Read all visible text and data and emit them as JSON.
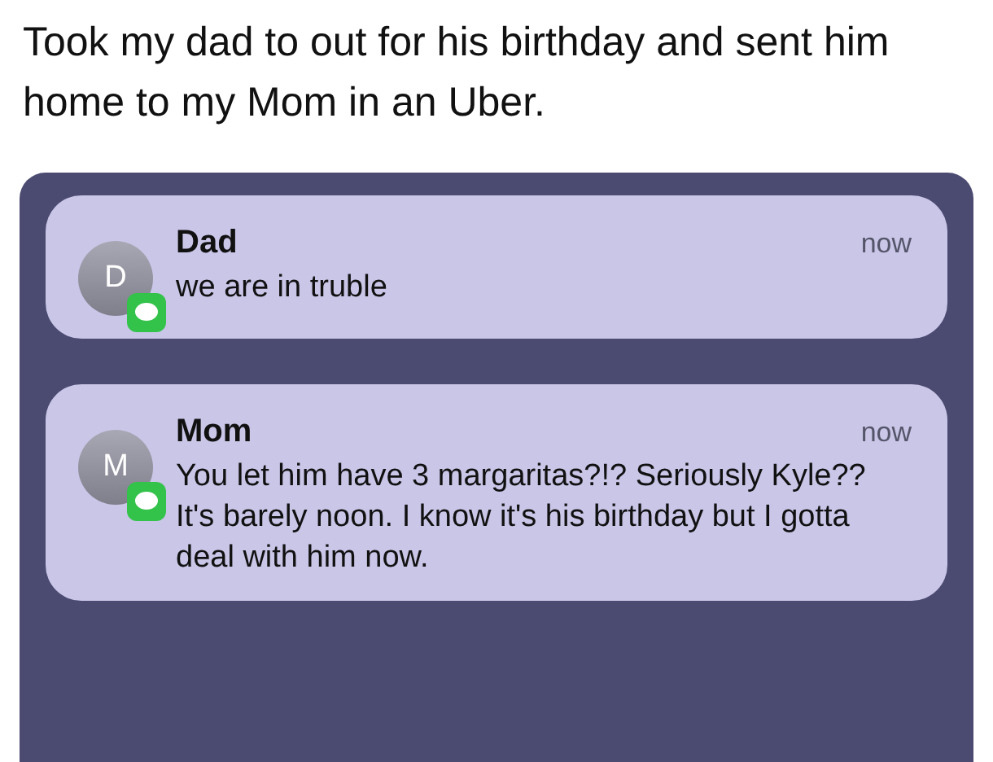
{
  "post": {
    "text": "Took my dad to out for his birthday and sent him home to my Mom in an Uber."
  },
  "notifications": [
    {
      "avatar": "D",
      "sender": "Dad",
      "time": "now",
      "message": "we are in truble"
    },
    {
      "avatar": "M",
      "sender": "Mom",
      "time": "now",
      "message": "You let him have 3 margaritas?!? Seriously Kyle?? It's barely noon. I know it's his birthday but I gotta deal with him now."
    }
  ]
}
